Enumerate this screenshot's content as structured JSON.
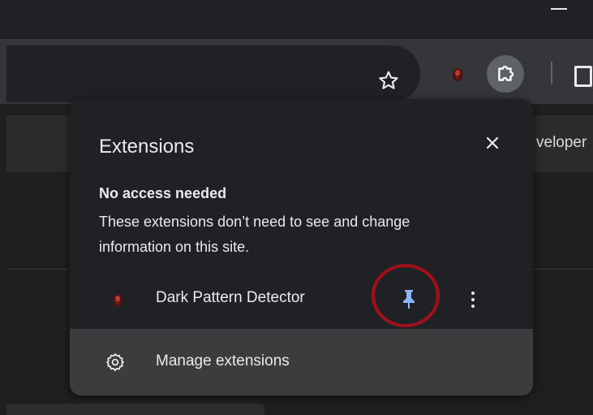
{
  "page": {
    "partial_link_text": "veloper"
  },
  "toolbar": {
    "icons": [
      "star-icon",
      "extension-icon",
      "puzzle-icon",
      "side-panel-icon"
    ]
  },
  "popup": {
    "title": "Extensions",
    "section_heading": "No access needed",
    "section_description": "These extensions don’t need to see and change information on this site.",
    "extensions": [
      {
        "name": "Dark Pattern Detector",
        "pinned": true
      }
    ],
    "manage_label": "Manage extensions"
  },
  "colors": {
    "pin_active": "#8ab4f8",
    "highlight_circle": "#a0101c"
  }
}
